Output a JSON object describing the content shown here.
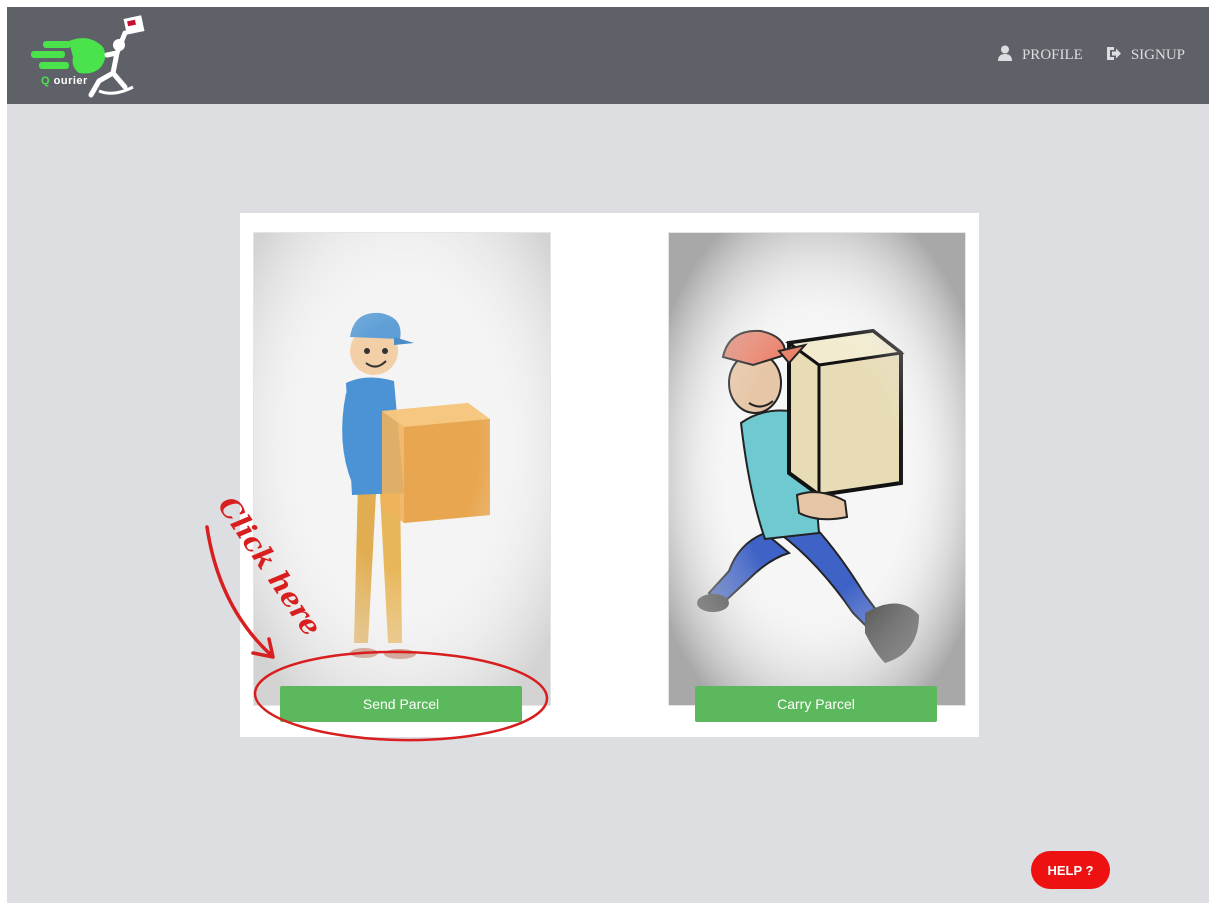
{
  "brand": {
    "logo_letter": "Q",
    "logo_word": "ourier",
    "accent_color": "#4be34b"
  },
  "nav": {
    "profile_label": "PROFILE",
    "profile_icon": "user-icon",
    "signup_label": "SIGNUP",
    "signup_icon": "sign-in-icon"
  },
  "options": {
    "send_label": "Send Parcel",
    "carry_label": "Carry Parcel",
    "button_color": "#5cb85c"
  },
  "annotation": {
    "text": "Click here",
    "color": "#d81e1e"
  },
  "help": {
    "label": "HELP ?",
    "color": "#ee1111"
  }
}
